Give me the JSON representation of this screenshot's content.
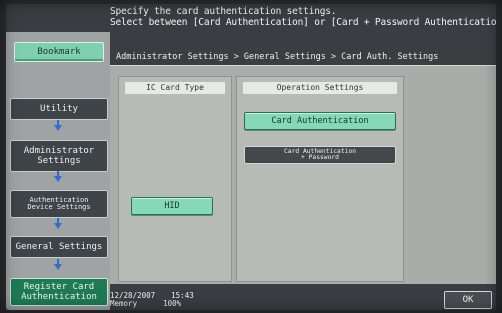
{
  "instruction": {
    "line1": "Specify the card authentication settings.",
    "line2": "Select between [Card Authentication] or [Card + Password Authentication]."
  },
  "sidebar": {
    "bookmark_label": "Bookmark",
    "items": [
      {
        "label": "Utility"
      },
      {
        "label": "Administrator\nSettings"
      },
      {
        "label": "Authentication\nDevice Settings"
      },
      {
        "label": "General Settings"
      },
      {
        "label": "Register Card\nAuthentication"
      }
    ]
  },
  "breadcrumb": "Administrator Settings > General Settings > Card Auth. Settings",
  "ic_card": {
    "header": "IC Card Type",
    "option": "HID"
  },
  "operation": {
    "header": "Operation Settings",
    "option1": "Card Authentication",
    "option2_line1": "Card Authentication",
    "option2_line2": "+ Password"
  },
  "status": {
    "date": "12/28/2007",
    "time": "15:43",
    "memory_label": "Memory",
    "memory_value": "100%"
  },
  "ok_label": "OK",
  "colors": {
    "accent_green": "#86d9b8",
    "active_nav": "#1f7a54",
    "arrow_blue": "#2d6ed0"
  }
}
